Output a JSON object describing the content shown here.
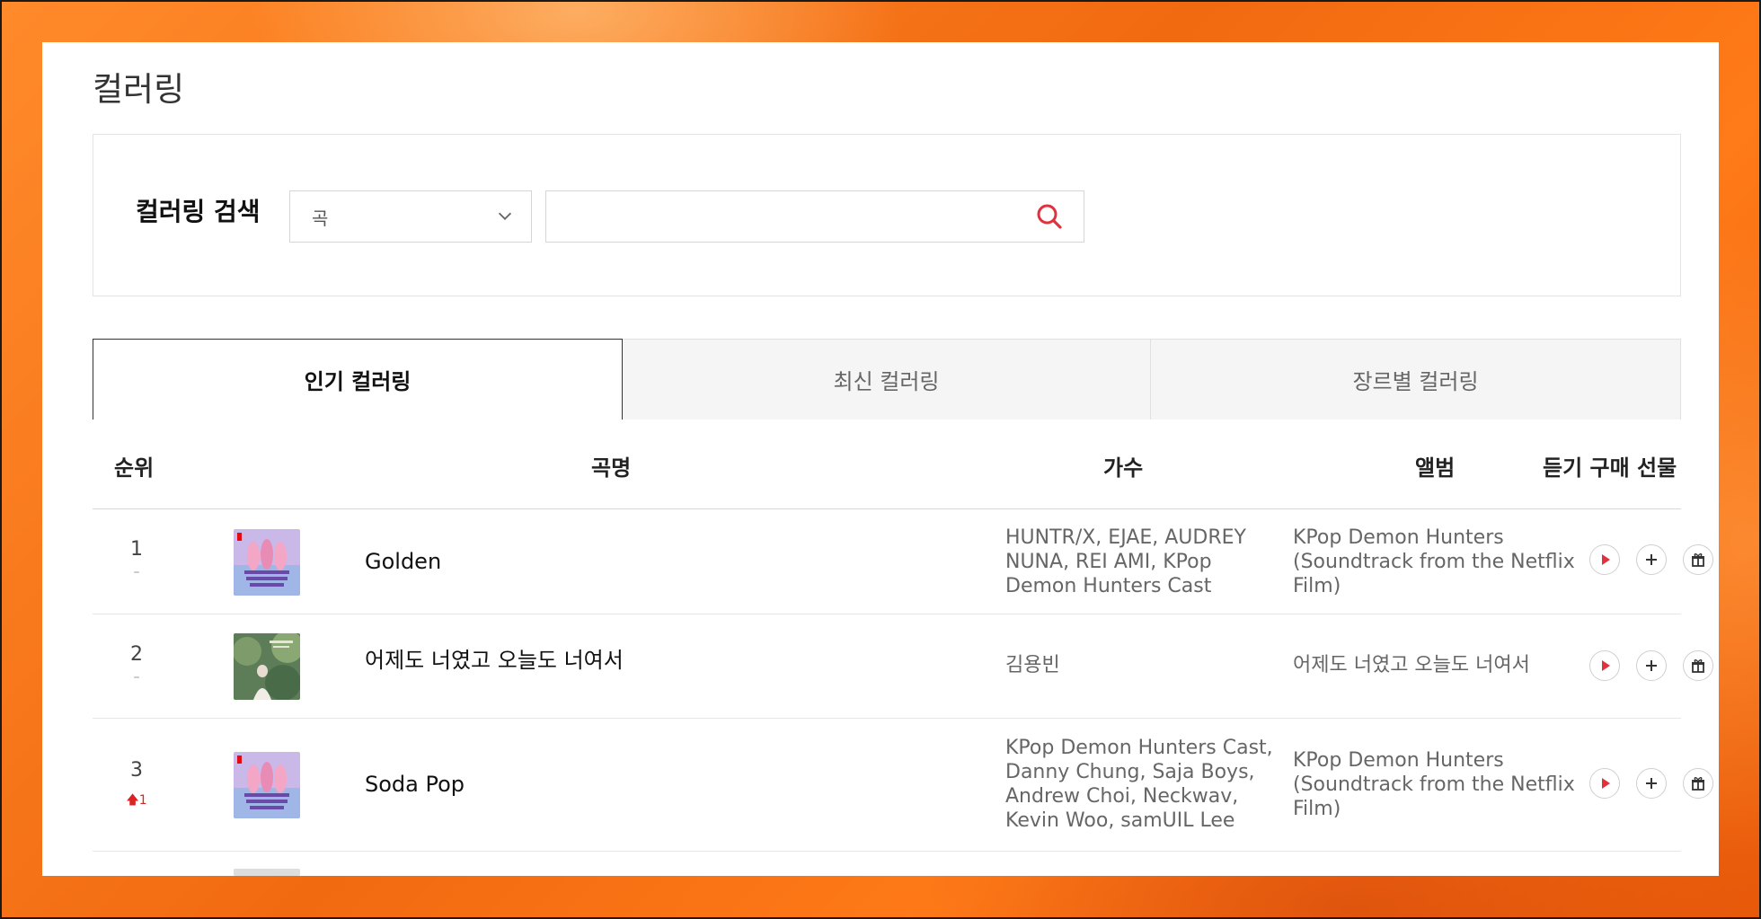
{
  "page": {
    "title": "컬러링"
  },
  "search": {
    "label": "컬러링 검색",
    "type_selected": "곡",
    "query_value": "",
    "placeholder": ""
  },
  "tabs": [
    {
      "label": "인기 컬러링",
      "active": true
    },
    {
      "label": "최신 컬러링",
      "active": false
    },
    {
      "label": "장르별 컬러링",
      "active": false
    }
  ],
  "table": {
    "headers": {
      "rank": "순위",
      "song": "곡명",
      "artist": "가수",
      "album": "앨범",
      "actions": "듣기 구매 선물"
    },
    "rows": [
      {
        "rank": "1",
        "change": "–",
        "song": "Golden",
        "artist": "HUNTR/X, EJAE, AUDREY NUNA, REI AMI, KPop Demon Hunters Cast",
        "album": "KPop Demon Hunters (Soundtrack from the Netflix Film)",
        "cover": "kpop-demon-hunters-cover"
      },
      {
        "rank": "2",
        "change": "–",
        "song": "어제도 너였고 오늘도 너여서",
        "artist": "김용빈",
        "album": "어제도 너였고 오늘도 너여서",
        "cover": "green-forest-cover"
      },
      {
        "rank": "3",
        "change": "1",
        "change_direction": "up",
        "song": "Soda Pop",
        "artist": "KPop Demon Hunters Cast, Danny Chung, Saja Boys, Andrew Choi, Neckwav, Kevin Woo, samUIL Lee",
        "album": "KPop Demon Hunters (Soundtrack from the Netflix Film)",
        "cover": "kpop-demon-hunters-cover"
      }
    ]
  },
  "icons": {
    "play": "play-icon",
    "add": "plus-icon",
    "gift": "gift-icon",
    "search": "search-icon",
    "dropdown": "chevron-down-icon",
    "rank_up": "arrow-up-icon"
  },
  "colors": {
    "accent_red": "#e0323c",
    "background_orange": "#f57a1c",
    "tab_border": "#333333"
  }
}
